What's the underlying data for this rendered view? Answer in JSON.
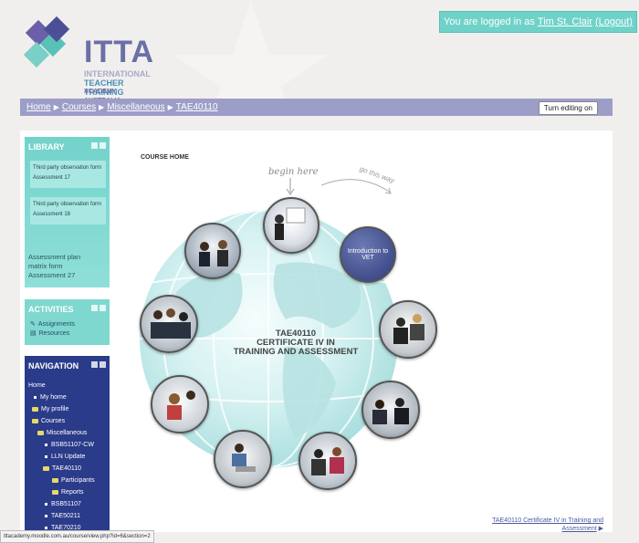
{
  "brand": {
    "logo_main": "ITTA",
    "logo_line1": "INTERNATIONAL",
    "logo_line2": "TEACHER TRAINING",
    "logo_line3": "ACADEMY AUSTRALIA"
  },
  "login": {
    "prefix": "You are logged in as",
    "user": "Tim St. Clair",
    "logout": "(Logout)"
  },
  "breadcrumb": [
    "Home",
    "Courses",
    "Miscellaneous",
    "TAE40110"
  ],
  "edit_button": "Turn editing on",
  "library": {
    "title": "LIBRARY",
    "items": [
      {
        "line1": "Third party observation form",
        "line2": "Assessment 17"
      },
      {
        "line1": "Third party observation form",
        "line2": "Assessment 18"
      }
    ],
    "footer": [
      "Assessment plan",
      "matrix form",
      "Assessment 27"
    ]
  },
  "activities": {
    "title": "ACTIVITIES",
    "items": [
      "Assignments",
      "Resources"
    ]
  },
  "navigation": {
    "title": "NAVIGATION",
    "items": [
      "Home",
      "My home",
      "My profile",
      "Courses",
      "Miscellaneous",
      "BSB51107-CW",
      "LLN Update",
      "TAE40110",
      "Participants",
      "Reports",
      "BSB51107",
      "TAE50211",
      "TAE70210"
    ]
  },
  "course": {
    "heading": "COURSE HOME",
    "begin_here": "begin here",
    "go_this_way": "go this way",
    "intro_label": "Introduction to VET",
    "title_line1": "TAE40110",
    "title_line2": "CERTIFICATE IV IN",
    "title_line3": "TRAINING AND ASSESSMENT"
  },
  "footer_link": {
    "line1": "TAE40110 Certificate IV in Training and",
    "line2": "Assessment"
  },
  "status_url": "ittacademy.moodle.com.au/course/view.php?id=6&section=2",
  "colors": {
    "accent_teal": "#6fd2c8",
    "nav_purple": "#9c9ec8",
    "navy": "#2a3b8a"
  }
}
